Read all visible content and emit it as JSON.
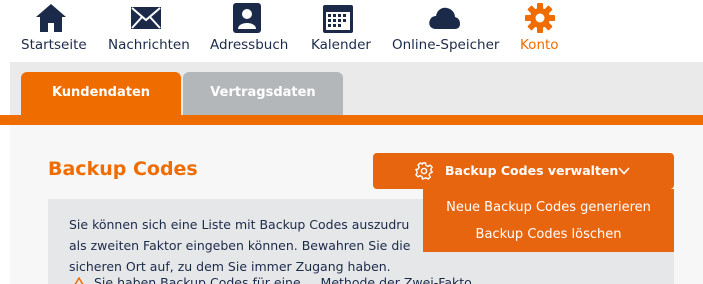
{
  "nav": {
    "items": [
      {
        "label": "Startseite",
        "icon": "home-icon"
      },
      {
        "label": "Nachrichten",
        "icon": "envelope-icon"
      },
      {
        "label": "Adressbuch",
        "icon": "contact-icon"
      },
      {
        "label": "Kalender",
        "icon": "calendar-icon"
      },
      {
        "label": "Online-Speicher",
        "icon": "cloud-icon"
      },
      {
        "label": "Konto",
        "icon": "gear-icon"
      }
    ],
    "active": "Konto"
  },
  "tabs": [
    {
      "label": "Kundendaten",
      "active": true
    },
    {
      "label": "Vertragsdaten",
      "active": false
    }
  ],
  "section": {
    "title": "Backup Codes",
    "manage_button": "Backup Codes verwalten",
    "info_lines": [
      "Sie können sich eine Liste mit Backup Codes auszudru",
      "als zweiten Faktor eingeben können. Bewahren Sie die",
      "sicheren Ort auf, zu dem Sie immer Zugang haben."
    ],
    "info_line4": "Sie haben Backup Codes für eine ... Methode der Zwei-Fakto"
  },
  "dropdown": {
    "items": [
      "Neue Backup Codes generieren",
      "Backup Codes löschen"
    ]
  },
  "colors": {
    "accent": "#ef6c00",
    "navy": "#1c2a4a",
    "tab_inactive": "#b4b7ba"
  }
}
